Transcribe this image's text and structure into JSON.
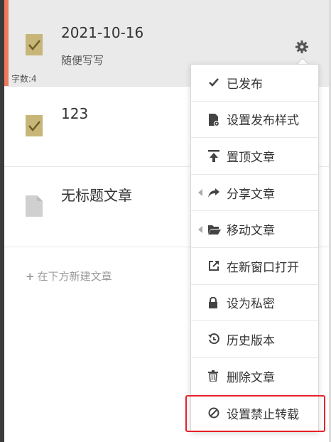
{
  "articles": [
    {
      "title": "2021-10-16",
      "summary": "随便写写",
      "word_count": "字数:4",
      "icon": "published-note-icon"
    },
    {
      "title": "123",
      "icon": "published-note-icon"
    },
    {
      "title": "无标题文章",
      "icon": "draft-document-icon"
    }
  ],
  "new_article_label": "在下方新建文章",
  "context_menu": {
    "items": [
      {
        "label": "已发布",
        "icon": "check-icon"
      },
      {
        "label": "设置发布样式",
        "icon": "document-style-icon"
      },
      {
        "label": "置顶文章",
        "icon": "pin-top-icon"
      },
      {
        "label": "分享文章",
        "icon": "share-icon"
      },
      {
        "label": "移动文章",
        "icon": "folder-open-icon"
      },
      {
        "label": "在新窗口打开",
        "icon": "external-link-icon"
      },
      {
        "label": "设为私密",
        "icon": "lock-icon"
      },
      {
        "label": "历史版本",
        "icon": "history-icon"
      },
      {
        "label": "删除文章",
        "icon": "trash-icon"
      },
      {
        "label": "设置禁止转载",
        "icon": "forbidden-icon"
      }
    ]
  },
  "colors": {
    "active_accent": "#f0795b",
    "highlight": "#e8202a",
    "note_icon": "#c7b677",
    "draft_icon": "#d0d0d0"
  }
}
